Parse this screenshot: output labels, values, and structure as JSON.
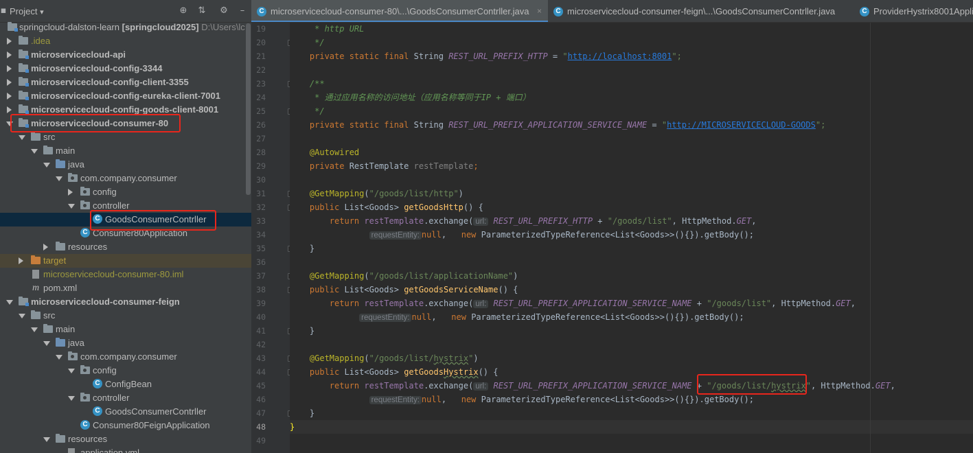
{
  "panel": {
    "title": "Project",
    "title_arrow": "▾",
    "icons": [
      "locate-icon",
      "collapse-icon",
      "gear-icon",
      "hide-icon"
    ]
  },
  "tree": [
    {
      "label": "springcloud-dalston-learn",
      "extra": "[springcloud2025]",
      "path": "D:\\Users\\lc",
      "kind": "root"
    },
    {
      "label": ".idea",
      "kind": "folder"
    },
    {
      "label": "microservicecloud-api",
      "kind": "module"
    },
    {
      "label": "microservicecloud-config-3344",
      "kind": "module"
    },
    {
      "label": "microservicecloud-config-client-3355",
      "kind": "module"
    },
    {
      "label": "microservicecloud-config-eureka-client-7001",
      "kind": "module"
    },
    {
      "label": "microservicecloud-config-goods-client-8001",
      "kind": "module"
    },
    {
      "label": "microservicecloud-consumer-80",
      "kind": "module"
    },
    {
      "label": "src",
      "kind": "folder"
    },
    {
      "label": "main",
      "kind": "folder"
    },
    {
      "label": "java",
      "kind": "folder"
    },
    {
      "label": "com.company.consumer",
      "kind": "package"
    },
    {
      "label": "config",
      "kind": "package"
    },
    {
      "label": "controller",
      "kind": "package"
    },
    {
      "label": "GoodsConsumerContrller",
      "kind": "class"
    },
    {
      "label": "Consumer80Application",
      "kind": "class"
    },
    {
      "label": "resources",
      "kind": "folder"
    },
    {
      "label": "target",
      "kind": "folder"
    },
    {
      "label": "microservicecloud-consumer-80.iml",
      "kind": "file"
    },
    {
      "label": "pom.xml",
      "kind": "file"
    },
    {
      "label": "microservicecloud-consumer-feign",
      "kind": "module"
    },
    {
      "label": "src",
      "kind": "folder"
    },
    {
      "label": "main",
      "kind": "folder"
    },
    {
      "label": "java",
      "kind": "folder"
    },
    {
      "label": "com.company.consumer",
      "kind": "package"
    },
    {
      "label": "config",
      "kind": "package"
    },
    {
      "label": "ConfigBean",
      "kind": "class"
    },
    {
      "label": "controller",
      "kind": "package"
    },
    {
      "label": "GoodsConsumerContrller",
      "kind": "class"
    },
    {
      "label": "Consumer80FeignApplication",
      "kind": "class"
    },
    {
      "label": "resources",
      "kind": "folder"
    },
    {
      "label": "application.yml",
      "kind": "file"
    }
  ],
  "tabs": [
    {
      "label": "microservicecloud-consumer-80\\...\\GoodsConsumerContrller.java",
      "close": "×"
    },
    {
      "label": "microservicecloud-consumer-feign\\...\\GoodsConsumerContrller.java"
    },
    {
      "label": "ProviderHystrix8001Appli"
    }
  ],
  "gutter": {
    "line_numbers": [
      19,
      20,
      21,
      22,
      23,
      24,
      25,
      26,
      27,
      28,
      29,
      30,
      31,
      32,
      33,
      34,
      35,
      36,
      37,
      38,
      39,
      40,
      41,
      42,
      43,
      44,
      45,
      46,
      47,
      48,
      49
    ]
  },
  "code": {
    "l19": " * http URL",
    "l20": " */",
    "l21_kw": "private static final ",
    "l21_type": "String ",
    "l21_const": "REST_URL_PREFIX_HTTP",
    "l21_eq": " = ",
    "l21_q1": "\"",
    "l21_url": "http://localhost:8001",
    "l21_end": "\";",
    "l23": "/**",
    "l24": " * 通过应用名称的访问地址（应用名称等同于IP + 端口）",
    "l25": " */",
    "l26_const": "REST_URL_PREFIX_APPLICATION_SERVICE_NAME",
    "l26_url": "http://MICROSERVICECLOUD-GOODS",
    "l28": "@Autowired",
    "l29_kw": "private ",
    "l29_type": "RestTemplate ",
    "l29_field": "restTemplate",
    "l29_end": ";",
    "get_mapping": "@GetMapping",
    "l31_str": "\"/goods/list/http\"",
    "l37_str": "\"/goods/list/applicationName\"",
    "l43_str_a": "\"/goods/list/",
    "l43_str_b": "hystrix",
    "l43_str_c": "\"",
    "paren_open": "(",
    "paren_close": ")",
    "public_kw": "public ",
    "list_type": "List<Goods> ",
    "m_http": "getGoodsHttp",
    "m_service": "getGoodsServiceName",
    "m_hys_a": "getGoods",
    "m_hys_b": "Hystrix",
    "sig_end": "() {",
    "return_kw": "return ",
    "rt_field": "restTemplate",
    "exchange": ".exchange(",
    "hint_url": "url:",
    "plus": " + ",
    "s_goods_list": "\"/goods/list\"",
    "s_goods_hys_a": "\"/goods/list/",
    "s_goods_hys_b": "hystrix",
    "s_goods_hys_c": "\"",
    "http_method": ", HttpMethod.",
    "get_const": "GET",
    "comma": ",",
    "hint_entity": "requestEntity:",
    "null_kw": "null",
    "new_part": ",   ",
    "new_kw": "new ",
    "ptr": "ParameterizedTypeReference<List<Goods>>(){}).getBody();",
    "close_brace": "}",
    "class_close": "}"
  },
  "colors": {
    "highlight_box": "#e8261c",
    "accent": "#4a88c7"
  }
}
